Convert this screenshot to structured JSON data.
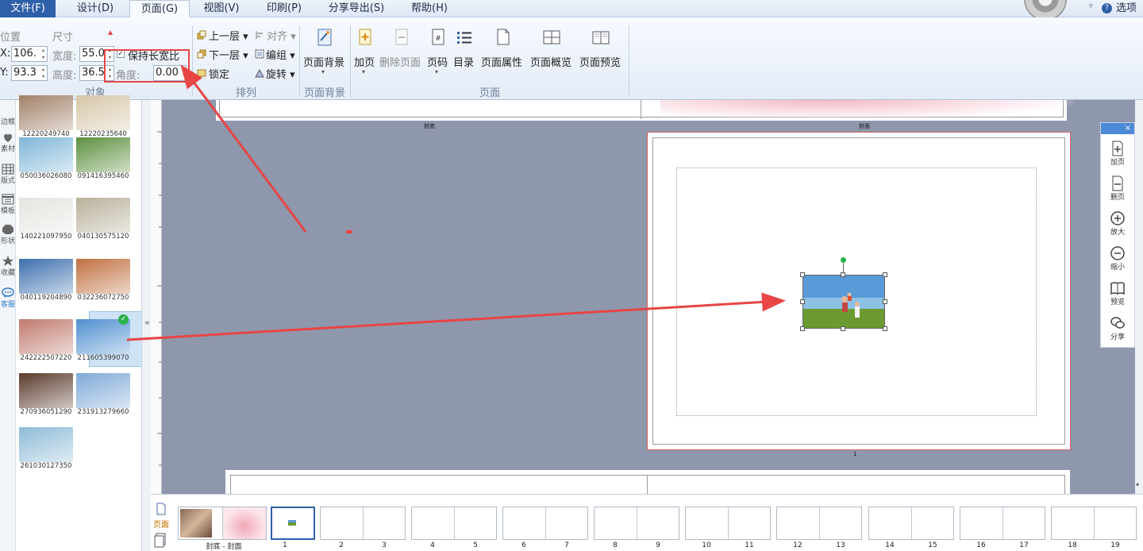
{
  "menu": {
    "file": "文件(F)",
    "design": "设计(D)",
    "page": "页面(G)",
    "view": "视图(V)",
    "print": "印刷(P)",
    "share": "分享导出(S)",
    "help": "帮助(H)",
    "options": "选项"
  },
  "ribbon": {
    "object_group": {
      "position_label": "位置",
      "size_label": "尺寸",
      "x_label": "X:",
      "x_value": "106.",
      "y_label": "Y:",
      "y_value": "93.3",
      "width_label": "宽度:",
      "width_value": "55.0",
      "height_label": "高度:",
      "height_value": "36.5",
      "keep_ratio_label": "保持长宽比",
      "angle_label": "角度:",
      "angle_value": "0.00",
      "group_label": "对象"
    },
    "arrange_group": {
      "up_layer": "上一层",
      "down_layer": "下一层",
      "lock": "锁定",
      "align": "对齐",
      "group": "编组",
      "rotate": "旋转",
      "group_label": "排列"
    },
    "background_group": {
      "bg_button": "页面背景",
      "group_label": "页面背景"
    },
    "page_group": {
      "add_page": "加页",
      "delete_page": "删除页面",
      "page_number": "页码",
      "toc": "目录",
      "page_props": "页面属性",
      "page_overview": "页面概览",
      "page_preview": "页面预览",
      "group_label": "页面"
    }
  },
  "left_tools": [
    {
      "label": "边框",
      "icon": "border-icon"
    },
    {
      "label": "素材",
      "icon": "material-icon"
    },
    {
      "label": "版式",
      "icon": "layout-icon"
    },
    {
      "label": "模板",
      "icon": "template-icon"
    },
    {
      "label": "形状",
      "icon": "shape-icon"
    },
    {
      "label": "收藏",
      "icon": "star-icon"
    },
    {
      "label": "客服",
      "icon": "chat-icon"
    }
  ],
  "photos": [
    {
      "name": "12220249740",
      "color": "#a08068"
    },
    {
      "name": "12220235640",
      "color": "#d6c6a8"
    },
    {
      "name": "050036026080",
      "color": "#7fb6d8"
    },
    {
      "name": "091416395460",
      "color": "#5c8f3e"
    },
    {
      "name": "140221097950",
      "color": "#e4e4e0"
    },
    {
      "name": "040130575120",
      "color": "#b8b09a"
    },
    {
      "name": "040119204890",
      "color": "#3d6fae"
    },
    {
      "name": "032236072750",
      "color": "#c07040"
    },
    {
      "name": "242222507220",
      "color": "#c07a6e"
    },
    {
      "name": "211605399070",
      "color": "#4f8fd0"
    },
    {
      "name": "270936051290",
      "color": "#5a3a2c"
    },
    {
      "name": "231913279660",
      "color": "#7fa9d8"
    },
    {
      "name": "261030127350",
      "color": "#8fbbd8"
    }
  ],
  "canvas": {
    "top_spread_left_label": "封底",
    "top_spread_right_label": "封面",
    "current_page_number": "1"
  },
  "float_panel": [
    {
      "label": "加页",
      "icon": "add-page-icon"
    },
    {
      "label": "删页",
      "icon": "delete-page-icon"
    },
    {
      "label": "放大",
      "icon": "zoom-in-icon"
    },
    {
      "label": "缩小",
      "icon": "zoom-out-icon"
    },
    {
      "label": "预览",
      "icon": "book-icon"
    },
    {
      "label": "分享",
      "icon": "wechat-icon"
    }
  ],
  "bottom": {
    "tab_page": "页面",
    "cover_label": "封底 - 封面",
    "page_numbers": [
      "1",
      "2",
      "3",
      "4",
      "5",
      "6",
      "7",
      "8",
      "9",
      "10",
      "11",
      "12",
      "13",
      "14",
      "15",
      "16",
      "17",
      "18",
      "19"
    ]
  },
  "colors": {
    "accent": "#2f5fa8",
    "annotation_red": "#e84545",
    "canvas_bg": "#8e97ac",
    "selection_green": "#2ab24a"
  }
}
